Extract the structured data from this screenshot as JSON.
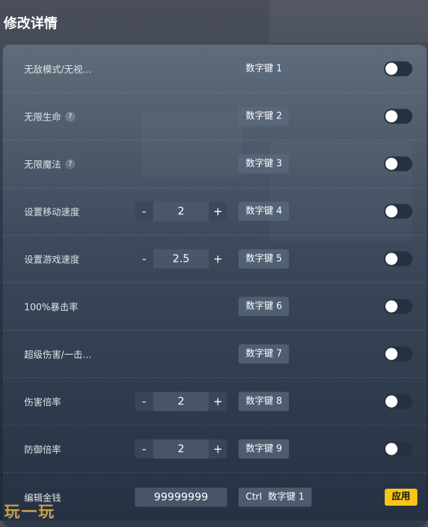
{
  "title": "修改详情",
  "rows": [
    {
      "label": "无敌模式/无视...",
      "hotkey": "数字键 1"
    },
    {
      "label": "无限生命",
      "hotkey": "数字键 2"
    },
    {
      "label": "无限魔法",
      "hotkey": "数字键 3"
    },
    {
      "label": "设置移动速度",
      "hotkey": "数字键 4",
      "value": "2"
    },
    {
      "label": "设置游戏速度",
      "hotkey": "数字键 5",
      "value": "2.5"
    },
    {
      "label": "100%暴击率",
      "hotkey": "数字键 6"
    },
    {
      "label": "超级伤害/一击...",
      "hotkey": "数字键 7"
    },
    {
      "label": "伤害倍率",
      "hotkey": "数字键 8",
      "value": "2"
    },
    {
      "label": "防御倍率",
      "hotkey": "数字键 9",
      "value": "2"
    },
    {
      "label": "编辑金钱",
      "hotkey": "Ctrl  数字键 1",
      "value": "99999999",
      "action": "应用"
    }
  ],
  "help_glyph": "?",
  "minus": "-",
  "plus": "+",
  "logo": "玩一玩"
}
